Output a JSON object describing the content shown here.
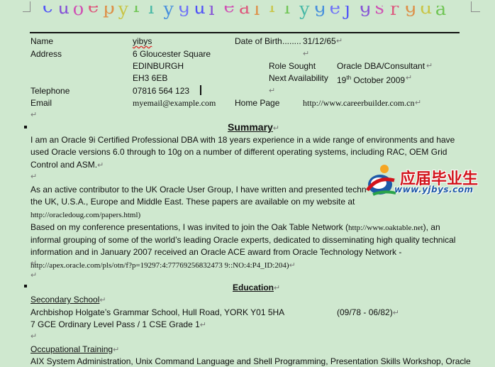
{
  "header": {
    "banner_letters": [
      "c",
      "u",
      "o",
      "e",
      "p",
      "y",
      "r",
      "l",
      "y",
      "g",
      "u",
      "i",
      "e",
      "a",
      "l",
      "l",
      "i",
      "y",
      "g",
      "e",
      "j",
      "g",
      "s",
      "r",
      "g",
      "d",
      "a"
    ]
  },
  "contact": {
    "name_label": "Name",
    "name_value": "yibys",
    "dob_label": "Date of Birth",
    "dob_dots": "........",
    "dob_value": "31/12/65",
    "address_label": "Address",
    "address_line1": "6 Gloucester Square",
    "address_line2": "EDINBURGH",
    "address_line3": "EH3 6EB",
    "role_label": "Role Sought",
    "role_value": "Oracle DBA/Consultant",
    "availability_label": "Next Availability",
    "availability_day": "19",
    "availability_suffix": "th",
    "availability_rest": " October 2009",
    "telephone_label": "Telephone",
    "telephone_value": "07816 564 123",
    "email_label": "Email",
    "email_value": "myemail@example.com",
    "homepage_label": "Home Page",
    "homepage_value": "http://www.careerbuilder.com.cn"
  },
  "marks": {
    "para": "↵"
  },
  "summary": {
    "title": "Summary",
    "p1": "I am an Oracle 9i Certified Professional DBA with 18 years experience in a wide range of environments and have used Oracle versions 6.0 through to 10g on a number of different operating systems, including RAC, OEM Grid Control and ASM.",
    "p2_a": "As an active contributor to the UK Oracle User Group, I have written and presented techn",
    "p2_b": "the UK, U.S.A., Europe and Middle East. These papers are available on my website at ",
    "p2_url": "http://oracledoug.com/papers.html)",
    "p2_c": "Based on my conference presentations, I was invited to join the Oak Table Network (",
    "p2_url2": "http://www.oaktable.net",
    "p2_d": "), an informal grouping of some of the world’s leading Oracle experts, dedicated to disseminating high quality technical information and in January 2007 received an Oracle ACE award from Oracle Technology Network - ",
    "p2_url3": "http://apex.oracle.com/pls/otn/f?p=19297:4:77769256832473 9::NO:4:P4_ID:204)"
  },
  "education": {
    "title": "Education",
    "secondary_title": "Secondary School",
    "school": "Archbishop Holgate’s Grammar School, Hull Road, YORK Y01 5HA",
    "school_dates": "(09/78 - 06/82)",
    "qualifications": "7 GCE Ordinary Level Pass / 1 CSE Grade 1",
    "occupational_title": "Occupational Training",
    "occupational_line": "AIX System Administration, Unix Command Language and Shell Programming, Presentation Skills Workshop, Oracle"
  },
  "watermark": {
    "cn_text": "应届毕业生",
    "url_text": "www.yjbys.com"
  },
  "colors": {
    "background": "#cfe8cf",
    "text": "#111111",
    "watermark_red": "#d2141c",
    "watermark_blue": "#1e5aa8"
  }
}
